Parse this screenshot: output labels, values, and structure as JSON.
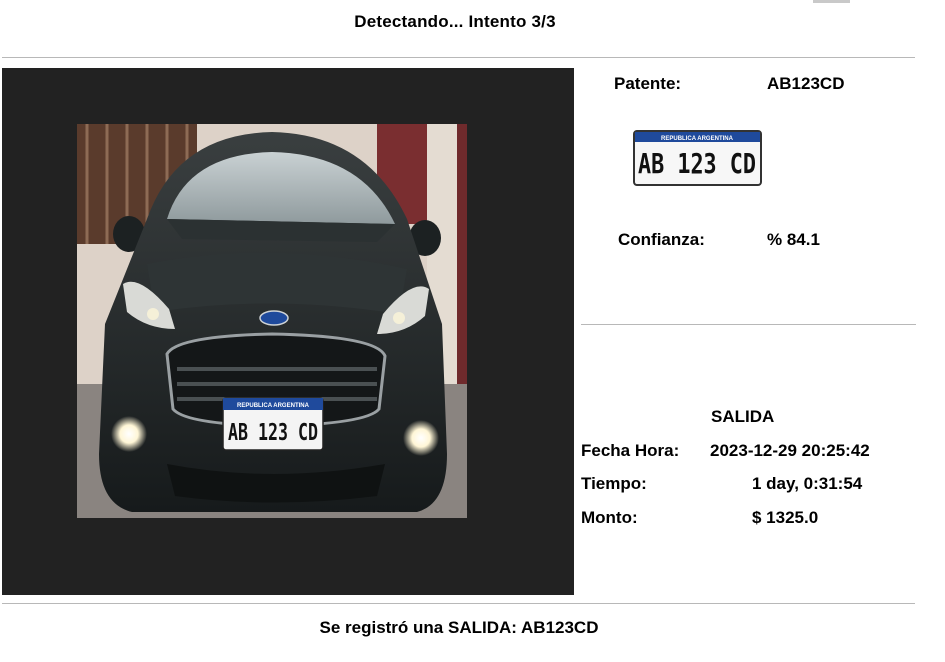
{
  "header": {
    "status": "Detectando... Intento 3/3"
  },
  "camera": {
    "plate_country": "REPUBLICA ARGENTINA",
    "plate_text": "AB 123 CD"
  },
  "detection": {
    "plate_label": "Patente:",
    "plate_value": "AB123CD",
    "thumb_country": "REPUBLICA ARGENTINA",
    "thumb_text": "AB 123 CD",
    "confidence_label": "Confianza:",
    "confidence_value": "% 84.1"
  },
  "event": {
    "title": "SALIDA",
    "datetime_label": "Fecha Hora:",
    "datetime_value": "2023-12-29 20:25:42",
    "time_label": "Tiempo:",
    "time_value": "1 day, 0:31:54",
    "amount_label": "Monto:",
    "amount_value": "$ 1325.0"
  },
  "footer": {
    "message": "Se registró una SALIDA: AB123CD"
  },
  "colors": {
    "panel_bg": "#222222",
    "plate_blue": "#1f4a9c",
    "divider": "#b8b8b8"
  }
}
